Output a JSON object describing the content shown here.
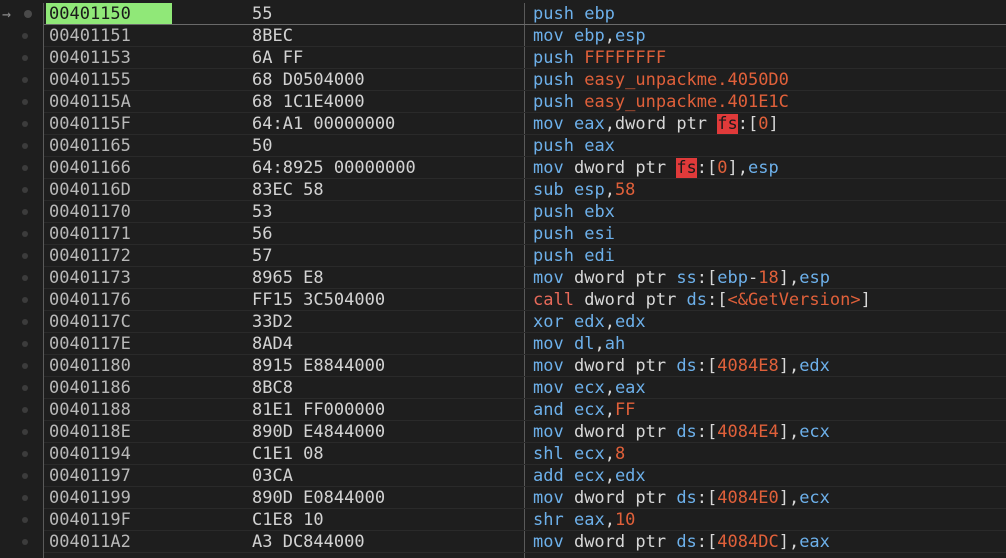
{
  "disassembly": {
    "rows": [
      {
        "address": "00401150",
        "bytes": "55",
        "current": true,
        "tokens": [
          {
            "t": "push",
            "c": "mnem"
          },
          {
            "t": " ",
            "c": "txt"
          },
          {
            "t": "ebp",
            "c": "reg"
          }
        ]
      },
      {
        "address": "00401151",
        "bytes": "8BEC",
        "tokens": [
          {
            "t": "mov",
            "c": "mnem"
          },
          {
            "t": " ",
            "c": "txt"
          },
          {
            "t": "ebp",
            "c": "reg"
          },
          {
            "t": ",",
            "c": "txt"
          },
          {
            "t": "esp",
            "c": "reg"
          }
        ]
      },
      {
        "address": "00401153",
        "bytes": "6A FF",
        "tokens": [
          {
            "t": "push",
            "c": "mnem"
          },
          {
            "t": " ",
            "c": "txt"
          },
          {
            "t": "FFFFFFFF",
            "c": "num"
          }
        ]
      },
      {
        "address": "00401155",
        "bytes": "68 D0504000",
        "tokens": [
          {
            "t": "push",
            "c": "mnem"
          },
          {
            "t": " ",
            "c": "txt"
          },
          {
            "t": "easy_unpackme.4050D0",
            "c": "sym"
          }
        ]
      },
      {
        "address": "0040115A",
        "bytes": "68 1C1E4000",
        "tokens": [
          {
            "t": "push",
            "c": "mnem"
          },
          {
            "t": " ",
            "c": "txt"
          },
          {
            "t": "easy_unpackme.401E1C",
            "c": "sym"
          }
        ]
      },
      {
        "address": "0040115F",
        "bytes": "64:A1 00000000",
        "tokens": [
          {
            "t": "mov",
            "c": "mnem"
          },
          {
            "t": " ",
            "c": "txt"
          },
          {
            "t": "eax",
            "c": "reg"
          },
          {
            "t": ",dword ptr ",
            "c": "txt"
          },
          {
            "t": "fs",
            "c": "fs"
          },
          {
            "t": ":[",
            "c": "txt"
          },
          {
            "t": "0",
            "c": "num"
          },
          {
            "t": "]",
            "c": "txt"
          }
        ]
      },
      {
        "address": "00401165",
        "bytes": "50",
        "tokens": [
          {
            "t": "push",
            "c": "mnem"
          },
          {
            "t": " ",
            "c": "txt"
          },
          {
            "t": "eax",
            "c": "reg"
          }
        ]
      },
      {
        "address": "00401166",
        "bytes": "64:8925 00000000",
        "tokens": [
          {
            "t": "mov",
            "c": "mnem"
          },
          {
            "t": " dword ptr ",
            "c": "txt"
          },
          {
            "t": "fs",
            "c": "fs"
          },
          {
            "t": ":[",
            "c": "txt"
          },
          {
            "t": "0",
            "c": "num"
          },
          {
            "t": "],",
            "c": "txt"
          },
          {
            "t": "esp",
            "c": "reg"
          }
        ]
      },
      {
        "address": "0040116D",
        "bytes": "83EC 58",
        "tokens": [
          {
            "t": "sub",
            "c": "mnem"
          },
          {
            "t": " ",
            "c": "txt"
          },
          {
            "t": "esp",
            "c": "reg"
          },
          {
            "t": ",",
            "c": "txt"
          },
          {
            "t": "58",
            "c": "num"
          }
        ]
      },
      {
        "address": "00401170",
        "bytes": "53",
        "tokens": [
          {
            "t": "push",
            "c": "mnem"
          },
          {
            "t": " ",
            "c": "txt"
          },
          {
            "t": "ebx",
            "c": "reg"
          }
        ]
      },
      {
        "address": "00401171",
        "bytes": "56",
        "tokens": [
          {
            "t": "push",
            "c": "mnem"
          },
          {
            "t": " ",
            "c": "txt"
          },
          {
            "t": "esi",
            "c": "reg"
          }
        ]
      },
      {
        "address": "00401172",
        "bytes": "57",
        "tokens": [
          {
            "t": "push",
            "c": "mnem"
          },
          {
            "t": " ",
            "c": "txt"
          },
          {
            "t": "edi",
            "c": "reg"
          }
        ]
      },
      {
        "address": "00401173",
        "bytes": "8965 E8",
        "tokens": [
          {
            "t": "mov",
            "c": "mnem"
          },
          {
            "t": " dword ptr ",
            "c": "txt"
          },
          {
            "t": "ss",
            "c": "seg"
          },
          {
            "t": ":[",
            "c": "txt"
          },
          {
            "t": "ebp",
            "c": "reg"
          },
          {
            "t": "-",
            "c": "txt"
          },
          {
            "t": "18",
            "c": "num"
          },
          {
            "t": "],",
            "c": "txt"
          },
          {
            "t": "esp",
            "c": "reg"
          }
        ]
      },
      {
        "address": "00401176",
        "bytes": "FF15 3C504000",
        "tokens": [
          {
            "t": "call",
            "c": "call"
          },
          {
            "t": " dword ptr ",
            "c": "txt"
          },
          {
            "t": "ds",
            "c": "seg"
          },
          {
            "t": ":[",
            "c": "txt"
          },
          {
            "t": "<&GetVersion>",
            "c": "sym"
          },
          {
            "t": "]",
            "c": "txt"
          }
        ]
      },
      {
        "address": "0040117C",
        "bytes": "33D2",
        "tokens": [
          {
            "t": "xor",
            "c": "mnem"
          },
          {
            "t": " ",
            "c": "txt"
          },
          {
            "t": "edx",
            "c": "reg"
          },
          {
            "t": ",",
            "c": "txt"
          },
          {
            "t": "edx",
            "c": "reg"
          }
        ]
      },
      {
        "address": "0040117E",
        "bytes": "8AD4",
        "tokens": [
          {
            "t": "mov",
            "c": "mnem"
          },
          {
            "t": " ",
            "c": "txt"
          },
          {
            "t": "dl",
            "c": "reg"
          },
          {
            "t": ",",
            "c": "txt"
          },
          {
            "t": "ah",
            "c": "reg"
          }
        ]
      },
      {
        "address": "00401180",
        "bytes": "8915 E8844000",
        "tokens": [
          {
            "t": "mov",
            "c": "mnem"
          },
          {
            "t": " dword ptr ",
            "c": "txt"
          },
          {
            "t": "ds",
            "c": "seg"
          },
          {
            "t": ":[",
            "c": "txt"
          },
          {
            "t": "4084E8",
            "c": "num"
          },
          {
            "t": "],",
            "c": "txt"
          },
          {
            "t": "edx",
            "c": "reg"
          }
        ]
      },
      {
        "address": "00401186",
        "bytes": "8BC8",
        "tokens": [
          {
            "t": "mov",
            "c": "mnem"
          },
          {
            "t": " ",
            "c": "txt"
          },
          {
            "t": "ecx",
            "c": "reg"
          },
          {
            "t": ",",
            "c": "txt"
          },
          {
            "t": "eax",
            "c": "reg"
          }
        ]
      },
      {
        "address": "00401188",
        "bytes": "81E1 FF000000",
        "tokens": [
          {
            "t": "and",
            "c": "mnem"
          },
          {
            "t": " ",
            "c": "txt"
          },
          {
            "t": "ecx",
            "c": "reg"
          },
          {
            "t": ",",
            "c": "txt"
          },
          {
            "t": "FF",
            "c": "num"
          }
        ]
      },
      {
        "address": "0040118E",
        "bytes": "890D E4844000",
        "tokens": [
          {
            "t": "mov",
            "c": "mnem"
          },
          {
            "t": " dword ptr ",
            "c": "txt"
          },
          {
            "t": "ds",
            "c": "seg"
          },
          {
            "t": ":[",
            "c": "txt"
          },
          {
            "t": "4084E4",
            "c": "num"
          },
          {
            "t": "],",
            "c": "txt"
          },
          {
            "t": "ecx",
            "c": "reg"
          }
        ]
      },
      {
        "address": "00401194",
        "bytes": "C1E1 08",
        "tokens": [
          {
            "t": "shl",
            "c": "mnem"
          },
          {
            "t": " ",
            "c": "txt"
          },
          {
            "t": "ecx",
            "c": "reg"
          },
          {
            "t": ",",
            "c": "txt"
          },
          {
            "t": "8",
            "c": "num"
          }
        ]
      },
      {
        "address": "00401197",
        "bytes": "03CA",
        "tokens": [
          {
            "t": "add",
            "c": "mnem"
          },
          {
            "t": " ",
            "c": "txt"
          },
          {
            "t": "ecx",
            "c": "reg"
          },
          {
            "t": ",",
            "c": "txt"
          },
          {
            "t": "edx",
            "c": "reg"
          }
        ]
      },
      {
        "address": "00401199",
        "bytes": "890D E0844000",
        "tokens": [
          {
            "t": "mov",
            "c": "mnem"
          },
          {
            "t": " dword ptr ",
            "c": "txt"
          },
          {
            "t": "ds",
            "c": "seg"
          },
          {
            "t": ":[",
            "c": "txt"
          },
          {
            "t": "4084E0",
            "c": "num"
          },
          {
            "t": "],",
            "c": "txt"
          },
          {
            "t": "ecx",
            "c": "reg"
          }
        ]
      },
      {
        "address": "0040119F",
        "bytes": "C1E8 10",
        "tokens": [
          {
            "t": "shr",
            "c": "mnem"
          },
          {
            "t": " ",
            "c": "txt"
          },
          {
            "t": "eax",
            "c": "reg"
          },
          {
            "t": ",",
            "c": "txt"
          },
          {
            "t": "10",
            "c": "num"
          }
        ]
      },
      {
        "address": "004011A2",
        "bytes": "A3 DC844000",
        "tokens": [
          {
            "t": "mov",
            "c": "mnem"
          },
          {
            "t": " dword ptr ",
            "c": "txt"
          },
          {
            "t": "ds",
            "c": "seg"
          },
          {
            "t": ":[",
            "c": "txt"
          },
          {
            "t": "4084DC",
            "c": "num"
          },
          {
            "t": "],",
            "c": "txt"
          },
          {
            "t": "eax",
            "c": "reg"
          }
        ]
      }
    ]
  },
  "colors": {
    "background": "#1e1e1e",
    "current_address_bg": "#90e878",
    "mnemonic": "#6db0ea",
    "call": "#e86a5a",
    "number": "#e0603a",
    "segment_highlight": "#e03a3a"
  },
  "icons": {
    "current_ip": "arrow-right-icon",
    "breakpoint_slot": "breakpoint-dot-icon"
  }
}
